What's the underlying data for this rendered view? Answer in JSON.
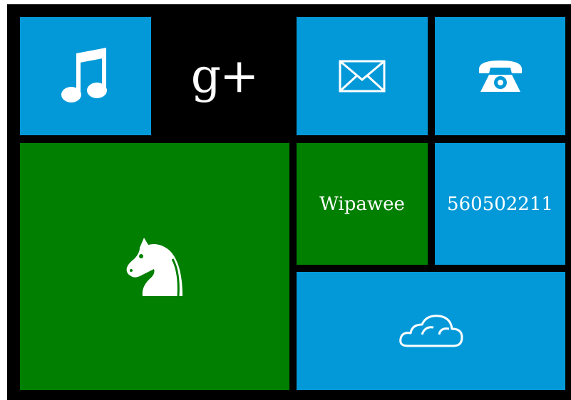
{
  "colors": {
    "background": "#000000",
    "blue": "#0399d8",
    "green": "#007f00",
    "black": "#000000",
    "foreground": "#ffffff"
  },
  "tiles": {
    "music": {
      "icon": "music-note-icon",
      "color": "#0399d8"
    },
    "gplus": {
      "label": "g+",
      "color": "#000000"
    },
    "mail": {
      "icon": "envelope-icon",
      "color": "#0399d8"
    },
    "phone": {
      "icon": "telephone-icon",
      "color": "#0399d8"
    },
    "chess": {
      "icon": "chess-knight-icon",
      "color": "#007f00"
    },
    "name": {
      "label": "Wipawee",
      "color": "#007f00"
    },
    "number": {
      "label": "560502211",
      "color": "#0399d8"
    },
    "cloud": {
      "icon": "cloud-icon",
      "color": "#0399d8"
    }
  }
}
